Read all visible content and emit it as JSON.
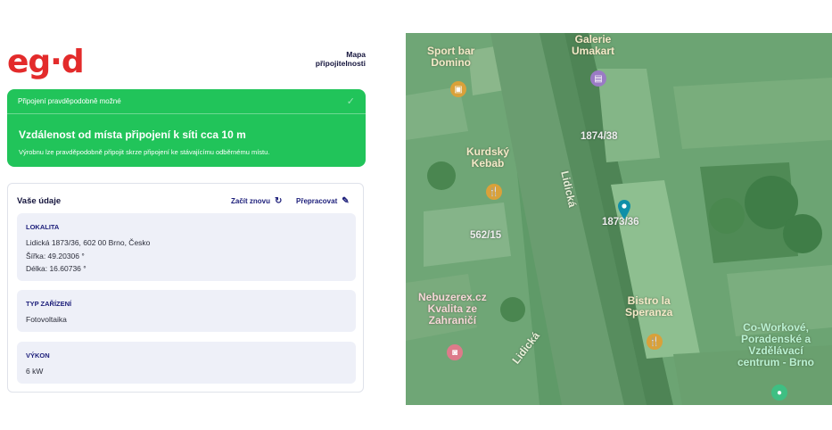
{
  "header": {
    "logo_text": "eg·d",
    "map_link": "Mapa připojitelnosti"
  },
  "status": {
    "heading": "Připojení pravděpodobně možné",
    "check_icon": "checkmark-icon",
    "title": "Vzdálenost od místa připojení k síti cca 10 m",
    "description": "Výrobnu lze pravděpodobně připojit skrze připojení ke stávajícímu odběrnému místu.",
    "color": "#21c45a"
  },
  "details": {
    "title": "Vaše údaje",
    "restart_label": "Začít znovu",
    "restart_icon": "refresh-icon",
    "recalc_label": "Přepracovat",
    "recalc_icon": "pencil-icon",
    "location": {
      "label": "LOKALITA",
      "address": "Lidická 1873/36, 602 00 Brno, Česko",
      "lat": "Šířka: 49.20306 °",
      "lon": "Délka: 16.60736 °"
    },
    "device": {
      "label": "TYP ZAŘÍZENÍ",
      "value": "Fotovoltaika"
    },
    "power": {
      "label": "VÝKON",
      "value": "6 kW"
    }
  },
  "map": {
    "labels": {
      "sport_bar": "Sport bar\nDomino",
      "galerie": "Galerie\nUmakart",
      "kurdsky": "Kurdský\nKebab",
      "bistro": "Bistro la\nSperanza",
      "cowork": "Co-Workové,\nPoradenské a\nVzdělávací\ncentrum - Brno",
      "nebu": "Nebuzerex.cz\nKvalita ze\nZahraničí"
    },
    "numbers": [
      "1874/38",
      "1873/36",
      "562/15"
    ],
    "streets": [
      "Lidická",
      "Lidická"
    ],
    "pin_color": "#0f8fa8"
  }
}
